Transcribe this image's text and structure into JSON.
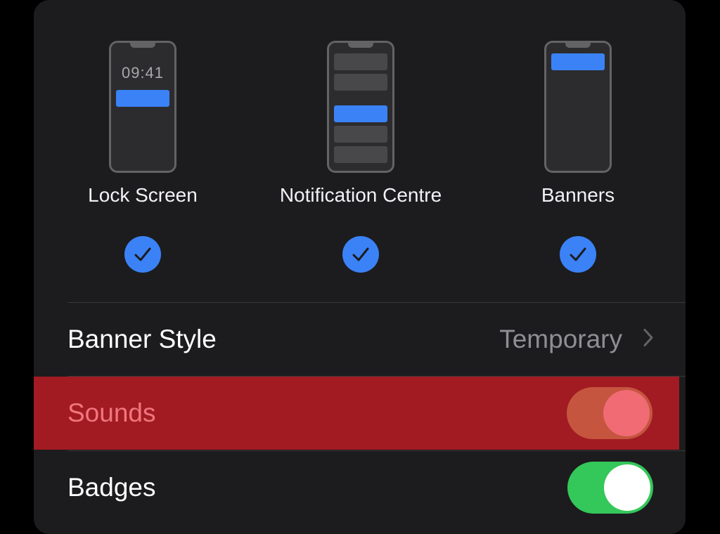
{
  "alert_options": [
    {
      "label": "Lock Screen",
      "time": "09:41",
      "checked": true
    },
    {
      "label": "Notification Centre",
      "checked": true
    },
    {
      "label": "Banners",
      "checked": true
    }
  ],
  "banner_style": {
    "label": "Banner Style",
    "value": "Temporary"
  },
  "sounds": {
    "label": "Sounds",
    "on": true
  },
  "badges": {
    "label": "Badges",
    "on": true
  },
  "colors": {
    "accent_blue": "#3b82f6",
    "highlight_red": "#a21b22",
    "toggle_green": "#34c759",
    "panel": "#1c1c1e"
  },
  "icons": [
    "checkmark-icon",
    "chevron-right-icon"
  ]
}
